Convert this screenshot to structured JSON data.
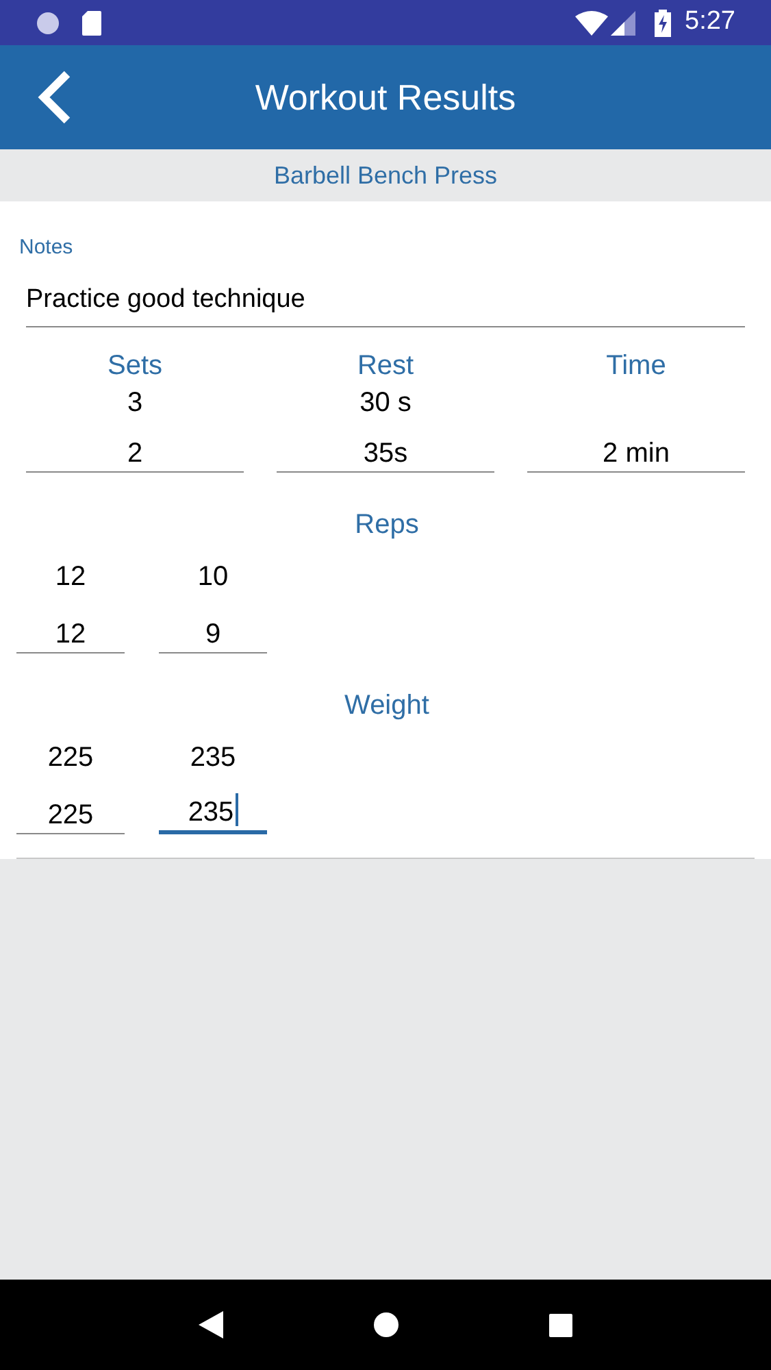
{
  "status_bar": {
    "time": "5:27"
  },
  "header": {
    "title": "Workout Results"
  },
  "exercise": "Barbell Bench Press",
  "notes": {
    "label": "Notes",
    "value": "Practice good technique"
  },
  "summary": [
    {
      "label": "Sets",
      "target": "3",
      "field": {
        "value": "2",
        "focused": false
      }
    },
    {
      "label": "Rest",
      "target": "30 s",
      "field": {
        "value": "35s",
        "focused": false
      }
    },
    {
      "label": "Time",
      "field": {
        "value": "2 min",
        "focused": false
      }
    }
  ],
  "sections": [
    {
      "label": "Reps",
      "sets": [
        {
          "target": "12",
          "field": {
            "value": "12",
            "focused": false
          }
        },
        {
          "target": "10",
          "field": {
            "value": "9",
            "focused": false
          }
        }
      ]
    },
    {
      "label": "Weight",
      "sets": [
        {
          "target": "225",
          "field": {
            "value": "225",
            "focused": false
          }
        },
        {
          "target": "235",
          "field": {
            "value": "235",
            "focused": true
          }
        }
      ]
    }
  ]
}
